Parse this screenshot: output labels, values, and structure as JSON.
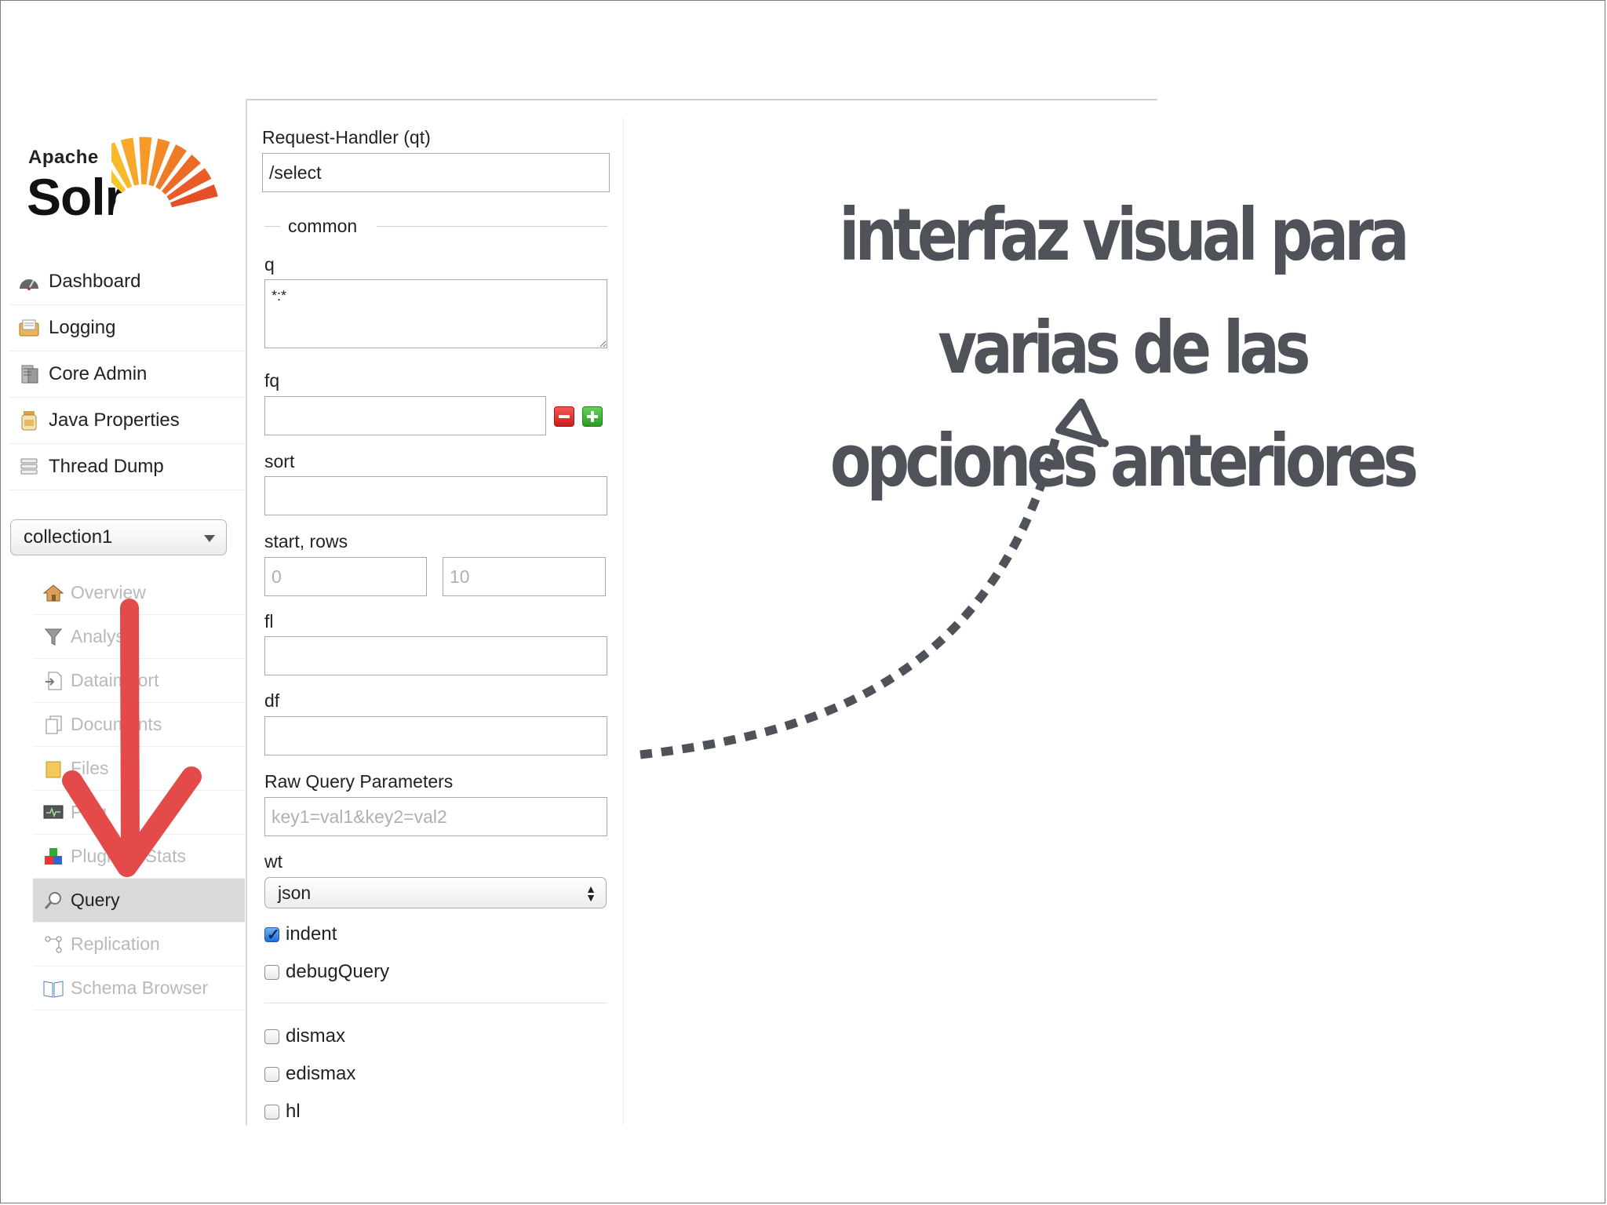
{
  "logo": {
    "apache": "Apache",
    "solr": "Solr"
  },
  "sidebar": {
    "items": [
      {
        "label": "Dashboard",
        "icon": "dashboard-icon"
      },
      {
        "label": "Logging",
        "icon": "logging-icon"
      },
      {
        "label": "Core Admin",
        "icon": "core-admin-icon"
      },
      {
        "label": "Java Properties",
        "icon": "java-properties-icon"
      },
      {
        "label": "Thread Dump",
        "icon": "thread-dump-icon"
      }
    ],
    "collection": "collection1",
    "subitems": [
      {
        "label": "Overview",
        "icon": "home-icon"
      },
      {
        "label": "Analysis",
        "icon": "funnel-icon"
      },
      {
        "label": "Dataimport",
        "icon": "dataimport-icon"
      },
      {
        "label": "Documents",
        "icon": "documents-icon"
      },
      {
        "label": "Files",
        "icon": "folder-icon"
      },
      {
        "label": "Ping",
        "icon": "monitor-icon"
      },
      {
        "label": "Plugins / Stats",
        "icon": "plugins-icon"
      },
      {
        "label": "Query",
        "icon": "magnifier-icon"
      },
      {
        "label": "Replication",
        "icon": "replication-icon"
      },
      {
        "label": "Schema Browser",
        "icon": "book-icon"
      }
    ],
    "active": "Query"
  },
  "form": {
    "qt_label": "Request-Handler (qt)",
    "qt_value": "/select",
    "common_legend": "common",
    "q_label": "q",
    "q_value": "*:*",
    "fq_label": "fq",
    "fq_value": "",
    "sort_label": "sort",
    "sort_value": "",
    "start_rows_label": "start, rows",
    "start_placeholder": "0",
    "rows_placeholder": "10",
    "fl_label": "fl",
    "fl_value": "",
    "df_label": "df",
    "df_value": "",
    "raw_label": "Raw Query Parameters",
    "raw_placeholder": "key1=val1&key2=val2",
    "wt_label": "wt",
    "wt_value": "json",
    "indent_label": "indent",
    "indent_checked": true,
    "debug_label": "debugQuery",
    "dismax_label": "dismax",
    "edismax_label": "edismax",
    "hl_label": "hl"
  },
  "annotation": {
    "line1": "interfaz visual para varias de las",
    "line2": "opciones anteriores",
    "text_color": "#4f5258",
    "arrow_down_color": "#e44a4a",
    "dotted_arrow_color": "#4f5258"
  }
}
